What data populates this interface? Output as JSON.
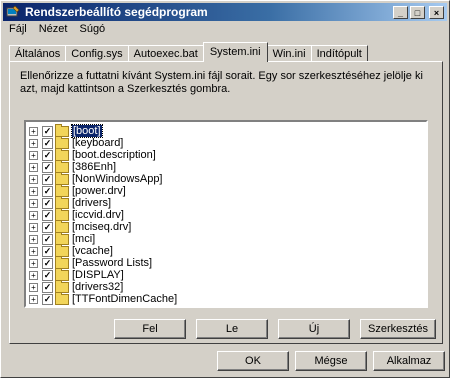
{
  "window": {
    "title": "Rendszerbeállító segédprogram",
    "controls": {
      "minimize": "_",
      "maximize": "□",
      "close": "×"
    }
  },
  "menu": [
    "Fájl",
    "Nézet",
    "Súgó"
  ],
  "tabs": [
    {
      "label": "Általános",
      "active": false
    },
    {
      "label": "Config.sys",
      "active": false
    },
    {
      "label": "Autoexec.bat",
      "active": false
    },
    {
      "label": "System.ini",
      "active": true
    },
    {
      "label": "Win.ini",
      "active": false
    },
    {
      "label": "Indítópult",
      "active": false
    }
  ],
  "description": "Ellenőrizze a futtatni kívánt System.ini fájl sorait. Egy sor szerkesztéséhez jelölje ki azt, majd kattintson a Szerkesztés gombra.",
  "tree_items": [
    {
      "label": "[boot]",
      "checked": true,
      "selected": true
    },
    {
      "label": "[keyboard]",
      "checked": true
    },
    {
      "label": "[boot.description]",
      "checked": true
    },
    {
      "label": "[386Enh]",
      "checked": true
    },
    {
      "label": "[NonWindowsApp]",
      "checked": true
    },
    {
      "label": "[power.drv]",
      "checked": true
    },
    {
      "label": "[drivers]",
      "checked": true
    },
    {
      "label": "[iccvid.drv]",
      "checked": true
    },
    {
      "label": "[mciseq.drv]",
      "checked": true
    },
    {
      "label": "[mci]",
      "checked": true
    },
    {
      "label": "[vcache]",
      "checked": true
    },
    {
      "label": "[Password Lists]",
      "checked": true
    },
    {
      "label": "[DISPLAY]",
      "checked": true
    },
    {
      "label": "[drivers32]",
      "checked": true
    },
    {
      "label": "[TTFontDimenCache]",
      "checked": true
    }
  ],
  "panel_buttons": {
    "up": "Fel",
    "down": "Le",
    "new": "Új",
    "edit": "Szerkesztés"
  },
  "dialog_buttons": {
    "ok": "OK",
    "cancel": "Mégse",
    "apply": "Alkalmaz"
  },
  "icons": {
    "app": "wrench-pc-icon",
    "expander": "plus-expander-icon",
    "folder": "folder-icon",
    "check": "checkmark-icon"
  },
  "colors": {
    "title_start": "#0a246a",
    "title_end": "#a6caf0",
    "selection": "#0a246a",
    "face": "#d4d0c8"
  }
}
